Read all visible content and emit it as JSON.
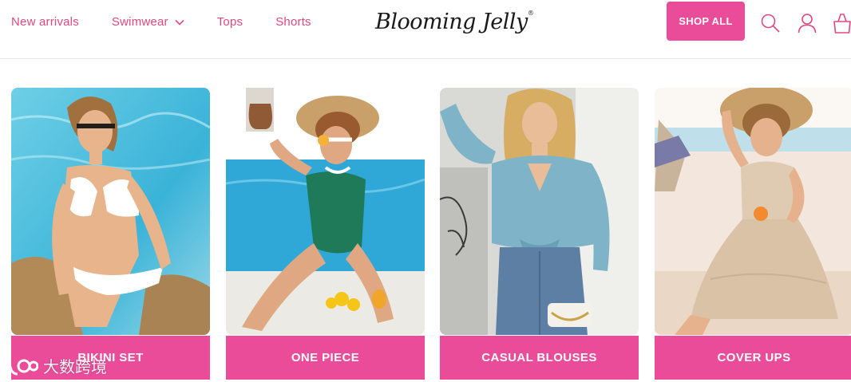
{
  "nav": {
    "items": [
      {
        "label": "New arrivals"
      },
      {
        "label": "Swimwear",
        "has_dropdown": true
      },
      {
        "label": "Tops"
      },
      {
        "label": "Shorts"
      }
    ]
  },
  "brand": {
    "name": "Blooming Jelly",
    "registered_mark": "®"
  },
  "header_actions": {
    "shop_all_label": "SHOP ALL",
    "icons": [
      "search-icon",
      "account-icon",
      "cart-icon"
    ]
  },
  "categories": [
    {
      "label": "BIKINI SET"
    },
    {
      "label": "ONE PIECE"
    },
    {
      "label": "CASUAL BLOUSES"
    },
    {
      "label": "COVER UPS"
    }
  ],
  "watermark": {
    "text": "大数跨境"
  },
  "colors": {
    "accent": "#ea4c9a",
    "nav_text": "#e0487f"
  }
}
